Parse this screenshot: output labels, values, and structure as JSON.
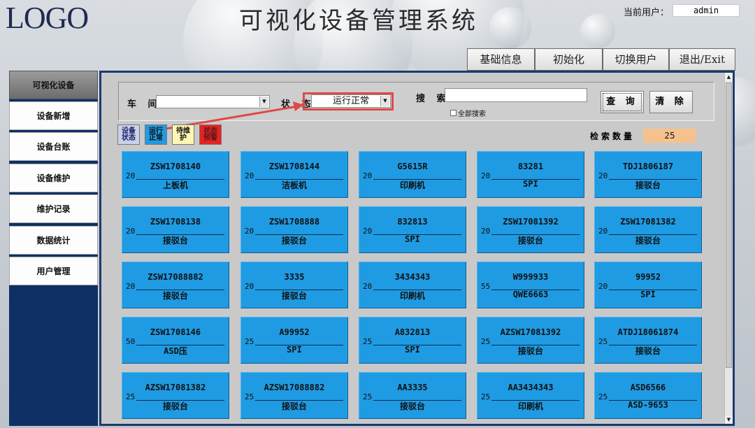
{
  "header": {
    "logo": "LOGO",
    "title": "可视化设备管理系统",
    "user_label": "当前用户：",
    "user_value": "admin"
  },
  "topnav": [
    "基础信息",
    "初始化",
    "切换用户",
    "退出/Exit"
  ],
  "sidebar": [
    "可视化设备",
    "设备新增",
    "设备台账",
    "设备维护",
    "维护记录",
    "数据统计",
    "用户管理"
  ],
  "filter": {
    "workshop_label": "车 间",
    "workshop_value": "",
    "status_label": "状 态",
    "status_value": "运行正常",
    "search_label": "搜 索",
    "search_value": "",
    "search_all_label": "全部搜索",
    "query_button": "查 询",
    "clear_button": "清 除"
  },
  "legend": [
    {
      "label": "设备状态",
      "color": "#c9d2e8"
    },
    {
      "label": "运行正常",
      "color": "#1f9be3"
    },
    {
      "label": "待维护",
      "color": "#fff7b3"
    },
    {
      "label": "状态预警",
      "color": "#e82222"
    }
  ],
  "count": {
    "label": "检索数量",
    "value": "25"
  },
  "devices": [
    {
      "code": "ZSW1708140",
      "num": "20",
      "kind": "上板机"
    },
    {
      "code": "ZSW1708144",
      "num": "20",
      "kind": "洁板机"
    },
    {
      "code": "G5615R",
      "num": "20",
      "kind": "印刷机"
    },
    {
      "code": "83281",
      "num": "20",
      "kind": "SPI"
    },
    {
      "code": "TDJ1806187",
      "num": "20",
      "kind": "接驳台"
    },
    {
      "code": "ZSW1708138",
      "num": "20",
      "kind": "接驳台"
    },
    {
      "code": "ZSW1708888",
      "num": "20",
      "kind": "接驳台"
    },
    {
      "code": "832813",
      "num": "20",
      "kind": "SPI"
    },
    {
      "code": "ZSW17081392",
      "num": "20",
      "kind": "接驳台"
    },
    {
      "code": "ZSW17081382",
      "num": "20",
      "kind": "接驳台"
    },
    {
      "code": "ZSW17088882",
      "num": "20",
      "kind": "接驳台"
    },
    {
      "code": "3335",
      "num": "20",
      "kind": "接驳台"
    },
    {
      "code": "3434343",
      "num": "20",
      "kind": "印刷机"
    },
    {
      "code": "W999933",
      "num": "55",
      "kind": "QWE6663"
    },
    {
      "code": "99952",
      "num": "20",
      "kind": "SPI"
    },
    {
      "code": "ZSW1708146",
      "num": "50",
      "kind": "ASD压"
    },
    {
      "code": "A99952",
      "num": "25",
      "kind": "SPI"
    },
    {
      "code": "A832813",
      "num": "25",
      "kind": "SPI"
    },
    {
      "code": "AZSW17081392",
      "num": "25",
      "kind": "接驳台"
    },
    {
      "code": "ATDJ18061874",
      "num": "25",
      "kind": "接驳台"
    },
    {
      "code": "AZSW17081382",
      "num": "25",
      "kind": "接驳台"
    },
    {
      "code": "AZSW17088882",
      "num": "25",
      "kind": "接驳台"
    },
    {
      "code": "AA3335",
      "num": "25",
      "kind": "接驳台"
    },
    {
      "code": "AA3434343",
      "num": "25",
      "kind": "印刷机"
    },
    {
      "code": "ASD6566",
      "num": "25",
      "kind": "ASD-9653"
    }
  ]
}
